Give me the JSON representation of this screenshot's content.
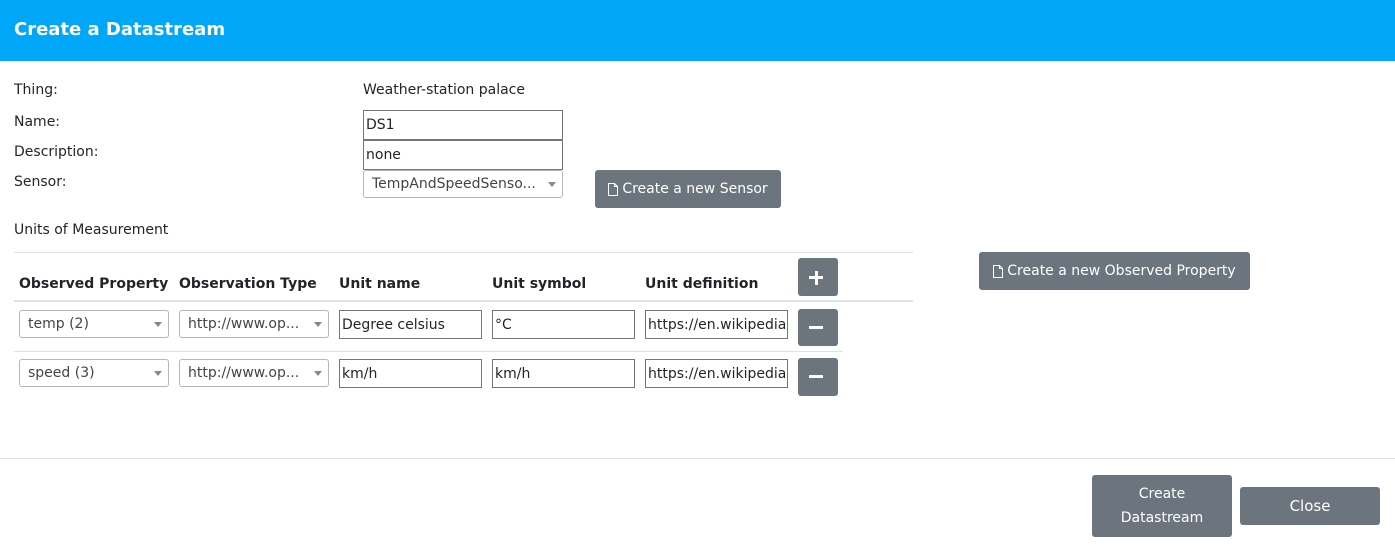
{
  "dialog": {
    "title": "Create a Datastream"
  },
  "form": {
    "thing_label": "Thing:",
    "thing_value": "Weather-station palace",
    "name_label": "Name:",
    "name_value": "DS1",
    "description_label": "Description:",
    "description_value": "none",
    "sensor_label": "Sensor:",
    "sensor_value": "TempAndSpeedSenso...",
    "create_sensor_label": "Create a new Sensor"
  },
  "units": {
    "section_label": "Units of Measurement",
    "columns": [
      "Observed Property",
      "Observation Type",
      "Unit name",
      "Unit symbol",
      "Unit definition"
    ],
    "rows": [
      {
        "observed_property": "temp (2)",
        "observation_type": "http://www.op...",
        "unit_name": "Degree celsius",
        "unit_symbol": "°C",
        "unit_definition": "https://en.wikipedia"
      },
      {
        "observed_property": "speed (3)",
        "observation_type": "http://www.op...",
        "unit_name": "km/h",
        "unit_symbol": "km/h",
        "unit_definition": "https://en.wikipedia"
      }
    ],
    "create_observed_property_label": "Create a new Observed Property"
  },
  "footer": {
    "create_line1": "Create",
    "create_line2": "Datastream",
    "close_label": "Close"
  },
  "icons": {
    "add": "plus-icon",
    "remove": "minus-icon",
    "document": "document-icon",
    "dropdown": "caret-down-icon"
  },
  "colors": {
    "header": "#00a7f9",
    "button": "#6c757d"
  }
}
